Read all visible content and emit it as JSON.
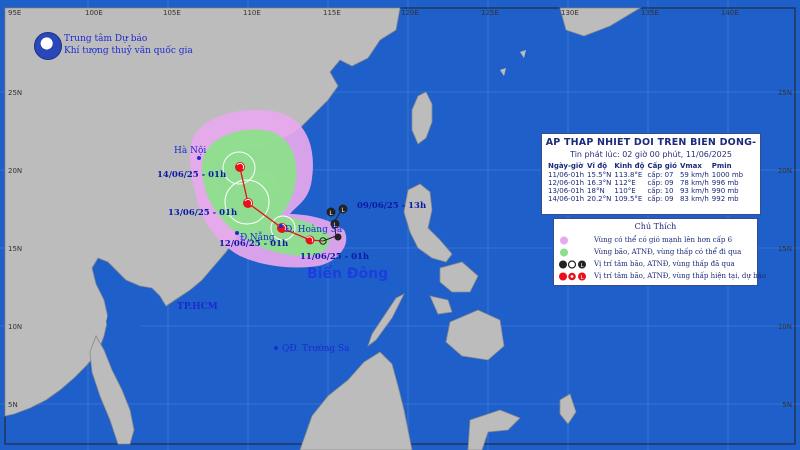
{
  "agency": {
    "line1": "Trung tâm Dự báo",
    "line2": "Khí tượng thuỷ văn quốc gia"
  },
  "map": {
    "lon_ticks": [
      "95E",
      "100E",
      "105E",
      "110E",
      "115E",
      "120E",
      "125E",
      "130E",
      "135E",
      "140E"
    ],
    "lat_ticks": [
      "25N",
      "20N",
      "15N",
      "10N",
      "5N"
    ],
    "lat_ticks_right": [
      "25N",
      "20N",
      "15N",
      "10N",
      "5N"
    ],
    "places": {
      "hanoi": "Hà Nội",
      "danang": "Đ.Nẵng",
      "hoangsa": "Đ. Hoàng Sa",
      "hcm": "TP.HCM",
      "truongsa": "QĐ. Trường Sa"
    },
    "sea_label": "Biển Đông",
    "track_labels": [
      "09/06/25 - 13h",
      "11/06/25 - 01h",
      "12/06/25 - 01h",
      "13/06/25 - 01h",
      "14/06/25 - 01h"
    ],
    "colors": {
      "sea": "#1e5fc9",
      "land": "#bcbcbc",
      "strong_wind_zone": "#e8a8ee",
      "danger_zone": "#8ce08c",
      "current_symbol": "#e8101a",
      "past_symbol": "#222222"
    }
  },
  "bulletin": {
    "title": "AP THAP NHIET DOI TREN BIEN DONG-",
    "issued": "Tin phát lúc: 02 giờ 00 phút, 11/06/2025",
    "headers": [
      "Ngày-giờ",
      "Vĩ độ",
      "Kinh độ",
      "Cấp gió",
      "Vmax",
      "Pmin"
    ],
    "rows": [
      [
        "11/06-01h",
        "15.5°N",
        "113.8°E",
        "cấp: 07",
        "59 km/h",
        "1000 mb"
      ],
      [
        "12/06-01h",
        "16.3°N",
        "112°E",
        "cấp: 09",
        "78 km/h",
        "996 mb"
      ],
      [
        "13/06-01h",
        "18°N",
        "110°E",
        "cấp: 10",
        "93 km/h",
        "990 mb"
      ],
      [
        "14/06-01h",
        "20.2°N",
        "109.5°E",
        "cấp: 09",
        "83 km/h",
        "992 mb"
      ]
    ]
  },
  "legend": {
    "title": "Chú Thích",
    "items": [
      "Vùng có thể có gió mạnh lên hơn cấp 6",
      "Vùng bão, ATNĐ, vùng thấp có thể đi qua",
      "Vị trí tâm bão, ATNĐ, vùng thấp đã qua",
      "Vị trí tâm bão, ATNĐ, vùng thấp hiện tại, dự báo"
    ]
  }
}
